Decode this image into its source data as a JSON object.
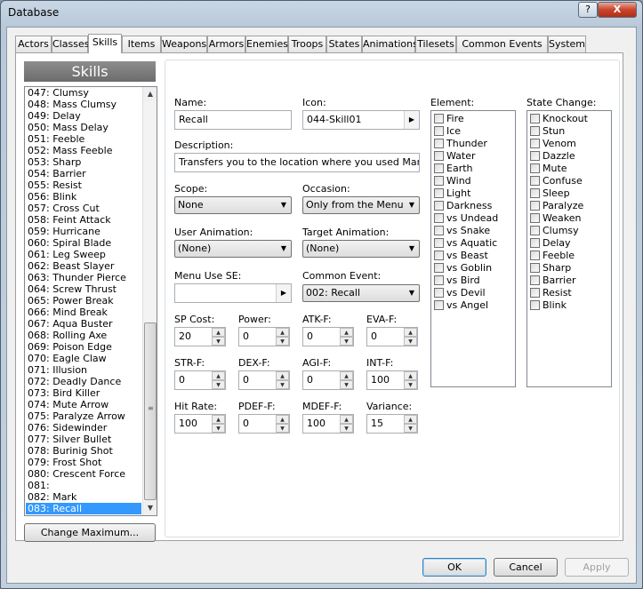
{
  "window": {
    "title": "Database",
    "help": "?",
    "close": "X"
  },
  "tabs": [
    "Actors",
    "Classes",
    "Skills",
    "Items",
    "Weapons",
    "Armors",
    "Enemies",
    "Troops",
    "States",
    "Animations",
    "Tilesets",
    "Common Events",
    "System"
  ],
  "active_tab": "Skills",
  "list": {
    "header": "Skills",
    "items": [
      "047: Clumsy",
      "048: Mass Clumsy",
      "049: Delay",
      "050: Mass Delay",
      "051: Feeble",
      "052: Mass Feeble",
      "053: Sharp",
      "054: Barrier",
      "055: Resist",
      "056: Blink",
      "057: Cross Cut",
      "058: Feint Attack",
      "059: Hurricane",
      "060: Spiral Blade",
      "061: Leg Sweep",
      "062: Beast Slayer",
      "063: Thunder Pierce",
      "064: Screw Thrust",
      "065: Power Break",
      "066: Mind Break",
      "067: Aqua Buster",
      "068: Rolling Axe",
      "069: Poison Edge",
      "070: Eagle Claw",
      "071: Illusion",
      "072: Deadly Dance",
      "073: Bird Killer",
      "074: Mute Arrow",
      "075: Paralyze Arrow",
      "076: Sidewinder",
      "077: Silver Bullet",
      "078: Burinig Shot",
      "079: Frost Shot",
      "080: Crescent Force",
      "081:",
      "082: Mark",
      "083: Recall"
    ],
    "selected": "083: Recall",
    "change_max_button": "Change Maximum..."
  },
  "form": {
    "name_label": "Name:",
    "name_value": "Recall",
    "icon_label": "Icon:",
    "icon_value": "044-Skill01",
    "description_label": "Description:",
    "description_value": "Transfers you to the location where you used Mark.",
    "scope_label": "Scope:",
    "scope_value": "None",
    "occasion_label": "Occasion:",
    "occasion_value": "Only from the Menu",
    "user_anim_label": "User Animation:",
    "user_anim_value": "(None)",
    "target_anim_label": "Target Animation:",
    "target_anim_value": "(None)",
    "menu_se_label": "Menu Use SE:",
    "menu_se_value": "",
    "common_event_label": "Common Event:",
    "common_event_value": "002: Recall",
    "params": [
      {
        "label": "SP Cost:",
        "value": "20"
      },
      {
        "label": "Power:",
        "value": "0"
      },
      {
        "label": "ATK-F:",
        "value": "0"
      },
      {
        "label": "EVA-F:",
        "value": "0"
      },
      {
        "label": "STR-F:",
        "value": "0"
      },
      {
        "label": "DEX-F:",
        "value": "0"
      },
      {
        "label": "AGI-F:",
        "value": "0"
      },
      {
        "label": "INT-F:",
        "value": "100"
      },
      {
        "label": "Hit Rate:",
        "value": "100"
      },
      {
        "label": "PDEF-F:",
        "value": "0"
      },
      {
        "label": "MDEF-F:",
        "value": "100"
      },
      {
        "label": "Variance:",
        "value": "15"
      }
    ],
    "element_label": "Element:",
    "elements": [
      "Fire",
      "Ice",
      "Thunder",
      "Water",
      "Earth",
      "Wind",
      "Light",
      "Darkness",
      "vs Undead",
      "vs Snake",
      "vs Aquatic",
      "vs Beast",
      "vs Goblin",
      "vs Bird",
      "vs Devil",
      "vs Angel"
    ],
    "state_label": "State Change:",
    "states": [
      "Knockout",
      "Stun",
      "Venom",
      "Dazzle",
      "Mute",
      "Confuse",
      "Sleep",
      "Paralyze",
      "Weaken",
      "Clumsy",
      "Delay",
      "Feeble",
      "Sharp",
      "Barrier",
      "Resist",
      "Blink"
    ]
  },
  "buttons": {
    "ok": "OK",
    "cancel": "Cancel",
    "apply": "Apply"
  }
}
